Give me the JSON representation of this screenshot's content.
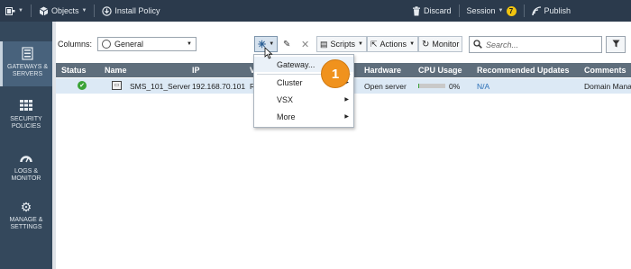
{
  "topbar": {
    "objects_label": "Objects",
    "install_policy_label": "Install Policy",
    "discard_label": "Discard",
    "session_label": "Session",
    "session_badge": "7",
    "publish_label": "Publish"
  },
  "leftnav": {
    "items": [
      {
        "label": "GATEWAYS & SERVERS",
        "icon": "gateways-servers-icon",
        "active": true
      },
      {
        "label": "SECURITY POLICIES",
        "icon": "security-policies-icon",
        "active": false
      },
      {
        "label": "LOGS & MONITOR",
        "icon": "logs-monitor-icon",
        "active": false
      },
      {
        "label": "MANAGE & SETTINGS",
        "icon": "manage-settings-icon",
        "active": false
      }
    ]
  },
  "toolbar": {
    "columns_label": "Columns:",
    "columns_value": "General",
    "scripts_label": "Scripts",
    "actions_label": "Actions",
    "monitor_label": "Monitor",
    "search_placeholder": "Search..."
  },
  "table": {
    "headers": [
      "Status",
      "Name",
      "IP",
      "V",
      "Hardware",
      "CPU Usage",
      "Recommended Updates",
      "Comments"
    ],
    "rows": [
      {
        "status": "ok",
        "name": "SMS_101_Server",
        "ip": "192.168.70.101",
        "version": "R",
        "hardware": "Open server",
        "cpu_usage": "0%",
        "cpu_fraction": 0.03,
        "updates": "N/A",
        "comments": "Domain Mana"
      }
    ]
  },
  "new_menu": {
    "items": [
      "Gateway...",
      "Cluster",
      "VSX",
      "More"
    ]
  },
  "callout": {
    "number": "1"
  },
  "colors": {
    "topbar": "#2b3a4c",
    "leftnav": "#34485c",
    "table_header": "#5f6e7c",
    "selected_row": "#dce9f5",
    "callout": "#f0921d",
    "link": "#2a6fb6"
  }
}
